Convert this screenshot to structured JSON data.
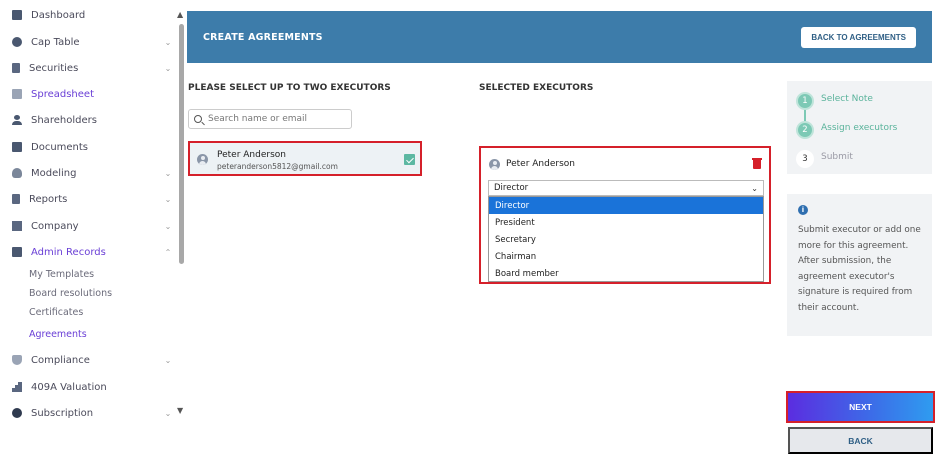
{
  "sidebar": {
    "items": [
      {
        "label": "Dashboard",
        "icon": "dashboard-icon"
      },
      {
        "label": "Cap Table",
        "icon": "pie-chart-icon"
      },
      {
        "label": "Securities",
        "icon": "clipboard-icon"
      },
      {
        "label": "Spreadsheet",
        "icon": "spreadsheet-icon"
      },
      {
        "label": "Shareholders",
        "icon": "user-icon"
      },
      {
        "label": "Documents",
        "icon": "documents-icon"
      },
      {
        "label": "Modeling",
        "icon": "bulb-icon"
      },
      {
        "label": "Reports",
        "icon": "reports-icon"
      },
      {
        "label": "Company",
        "icon": "building-icon"
      },
      {
        "label": "Admin Records",
        "icon": "admin-icon"
      },
      {
        "label": "Compliance",
        "icon": "shield-icon"
      },
      {
        "label": "409A Valuation",
        "icon": "chart-icon"
      },
      {
        "label": "Subscription",
        "icon": "coin-icon"
      }
    ],
    "admin_sub": [
      "My Templates",
      "Board resolutions",
      "Certificates",
      "Agreements"
    ]
  },
  "header": {
    "title": "CREATE AGREEMENTS",
    "back_label": "BACK TO AGREEMENTS"
  },
  "left": {
    "title": "PLEASE SELECT UP TO TWO EXECUTORS",
    "search_placeholder": "Search name or email",
    "executor": {
      "name": "Peter Anderson",
      "email": "peteranderson5812@gmail.com"
    }
  },
  "right": {
    "title": "SELECTED EXECUTORS",
    "executor_name": "Peter Anderson",
    "role_selected": "Director",
    "role_options": [
      "Director",
      "President",
      "Secretary",
      "Chairman",
      "Board member"
    ]
  },
  "stepper": {
    "steps": [
      {
        "num": "1",
        "label": "Select Note"
      },
      {
        "num": "2",
        "label": "Assign executors"
      },
      {
        "num": "3",
        "label": "Submit"
      }
    ]
  },
  "info": {
    "text": "Submit executor or add one more for this agreement. After submission, the agreement executor's signature is required from their account."
  },
  "actions": {
    "next": "NEXT",
    "back": "BACK"
  },
  "colors": {
    "header": "#3d7caa",
    "accent": "#6a3fd6",
    "highlight": "#d5202a",
    "step_done": "#7dc9b5"
  }
}
